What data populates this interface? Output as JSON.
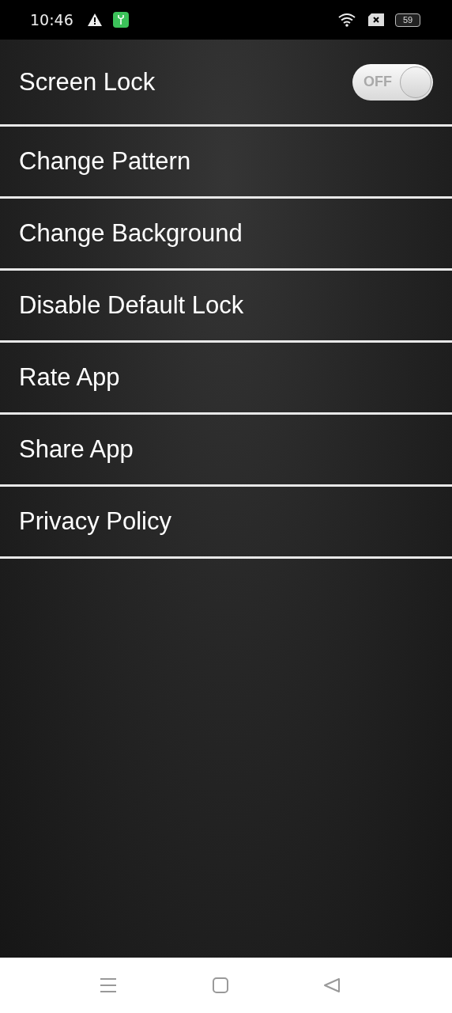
{
  "status_bar": {
    "time": "10:46",
    "battery": "59"
  },
  "settings": [
    {
      "kind": "toggle",
      "label": "Screen Lock",
      "on": false,
      "switch_text": "OFF"
    },
    {
      "kind": "link",
      "label": "Change Pattern"
    },
    {
      "kind": "link",
      "label": "Change Background"
    },
    {
      "kind": "link",
      "label": "Disable Default Lock"
    },
    {
      "kind": "link",
      "label": "Rate App"
    },
    {
      "kind": "link",
      "label": "Share App"
    },
    {
      "kind": "link",
      "label": "Privacy Policy"
    }
  ]
}
